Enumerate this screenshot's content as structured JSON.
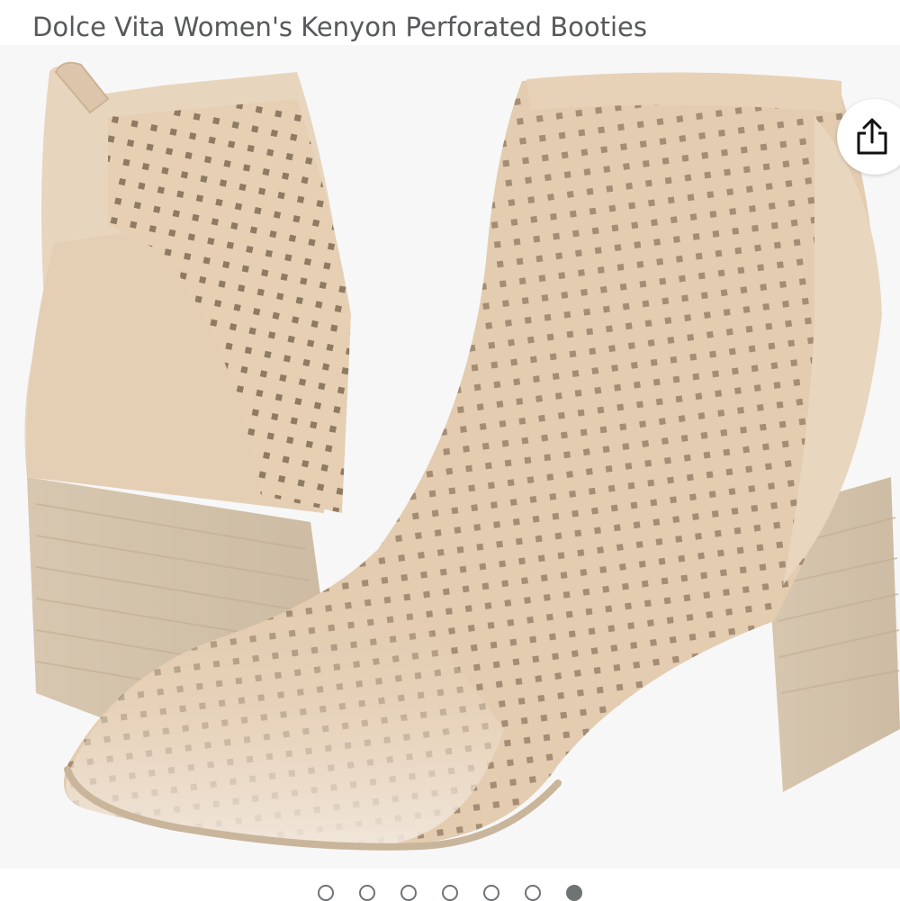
{
  "product": {
    "title": "Dolce Vita Women's Kenyon Perforated Booties"
  },
  "gallery": {
    "image_alt": "Dolce Vita Women's Kenyon Perforated Booties",
    "total_images": 7,
    "active_index": 6
  },
  "icons": {
    "share": "share-icon"
  },
  "colors": {
    "boot_leather": "#e8d3b8",
    "heel_wood": "#d9c9b3",
    "dot_inactive_border": "#6f7373",
    "dot_active": "#6f7373",
    "title_text": "#565959"
  }
}
